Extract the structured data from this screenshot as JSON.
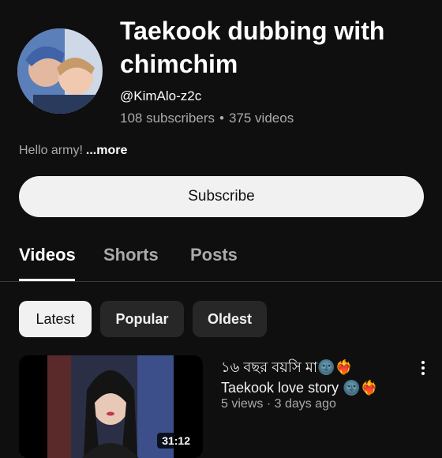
{
  "channel": {
    "title": "Taekook dubbing with chimchim",
    "handle": "@KimAlo-z2c",
    "subscribers": "108 subscribers",
    "separator": "•",
    "videos": "375 videos",
    "description": "Hello army!",
    "more_label": "...more",
    "avatar_icon": "channel-avatar"
  },
  "subscribe_label": "Subscribe",
  "tabs": [
    {
      "label": "Videos",
      "active": true
    },
    {
      "label": "Shorts",
      "active": false
    },
    {
      "label": "Posts",
      "active": false
    }
  ],
  "filters": [
    {
      "label": "Latest",
      "selected": true
    },
    {
      "label": "Popular",
      "selected": false
    },
    {
      "label": "Oldest",
      "selected": false
    }
  ],
  "video": {
    "title_line1": "১৬ বছর বয়সি মা🌚❤️‍🔥",
    "title_line2": "Taekook love story 🌚❤️‍🔥",
    "views": "5 views",
    "dot": "·",
    "age": "3 days ago",
    "duration": "31:12"
  },
  "colors": {
    "background": "#0f0f0f",
    "chip_bg": "#272727",
    "subscribe_bg": "#f1f1f1",
    "secondary_text": "#aaaaaa"
  }
}
